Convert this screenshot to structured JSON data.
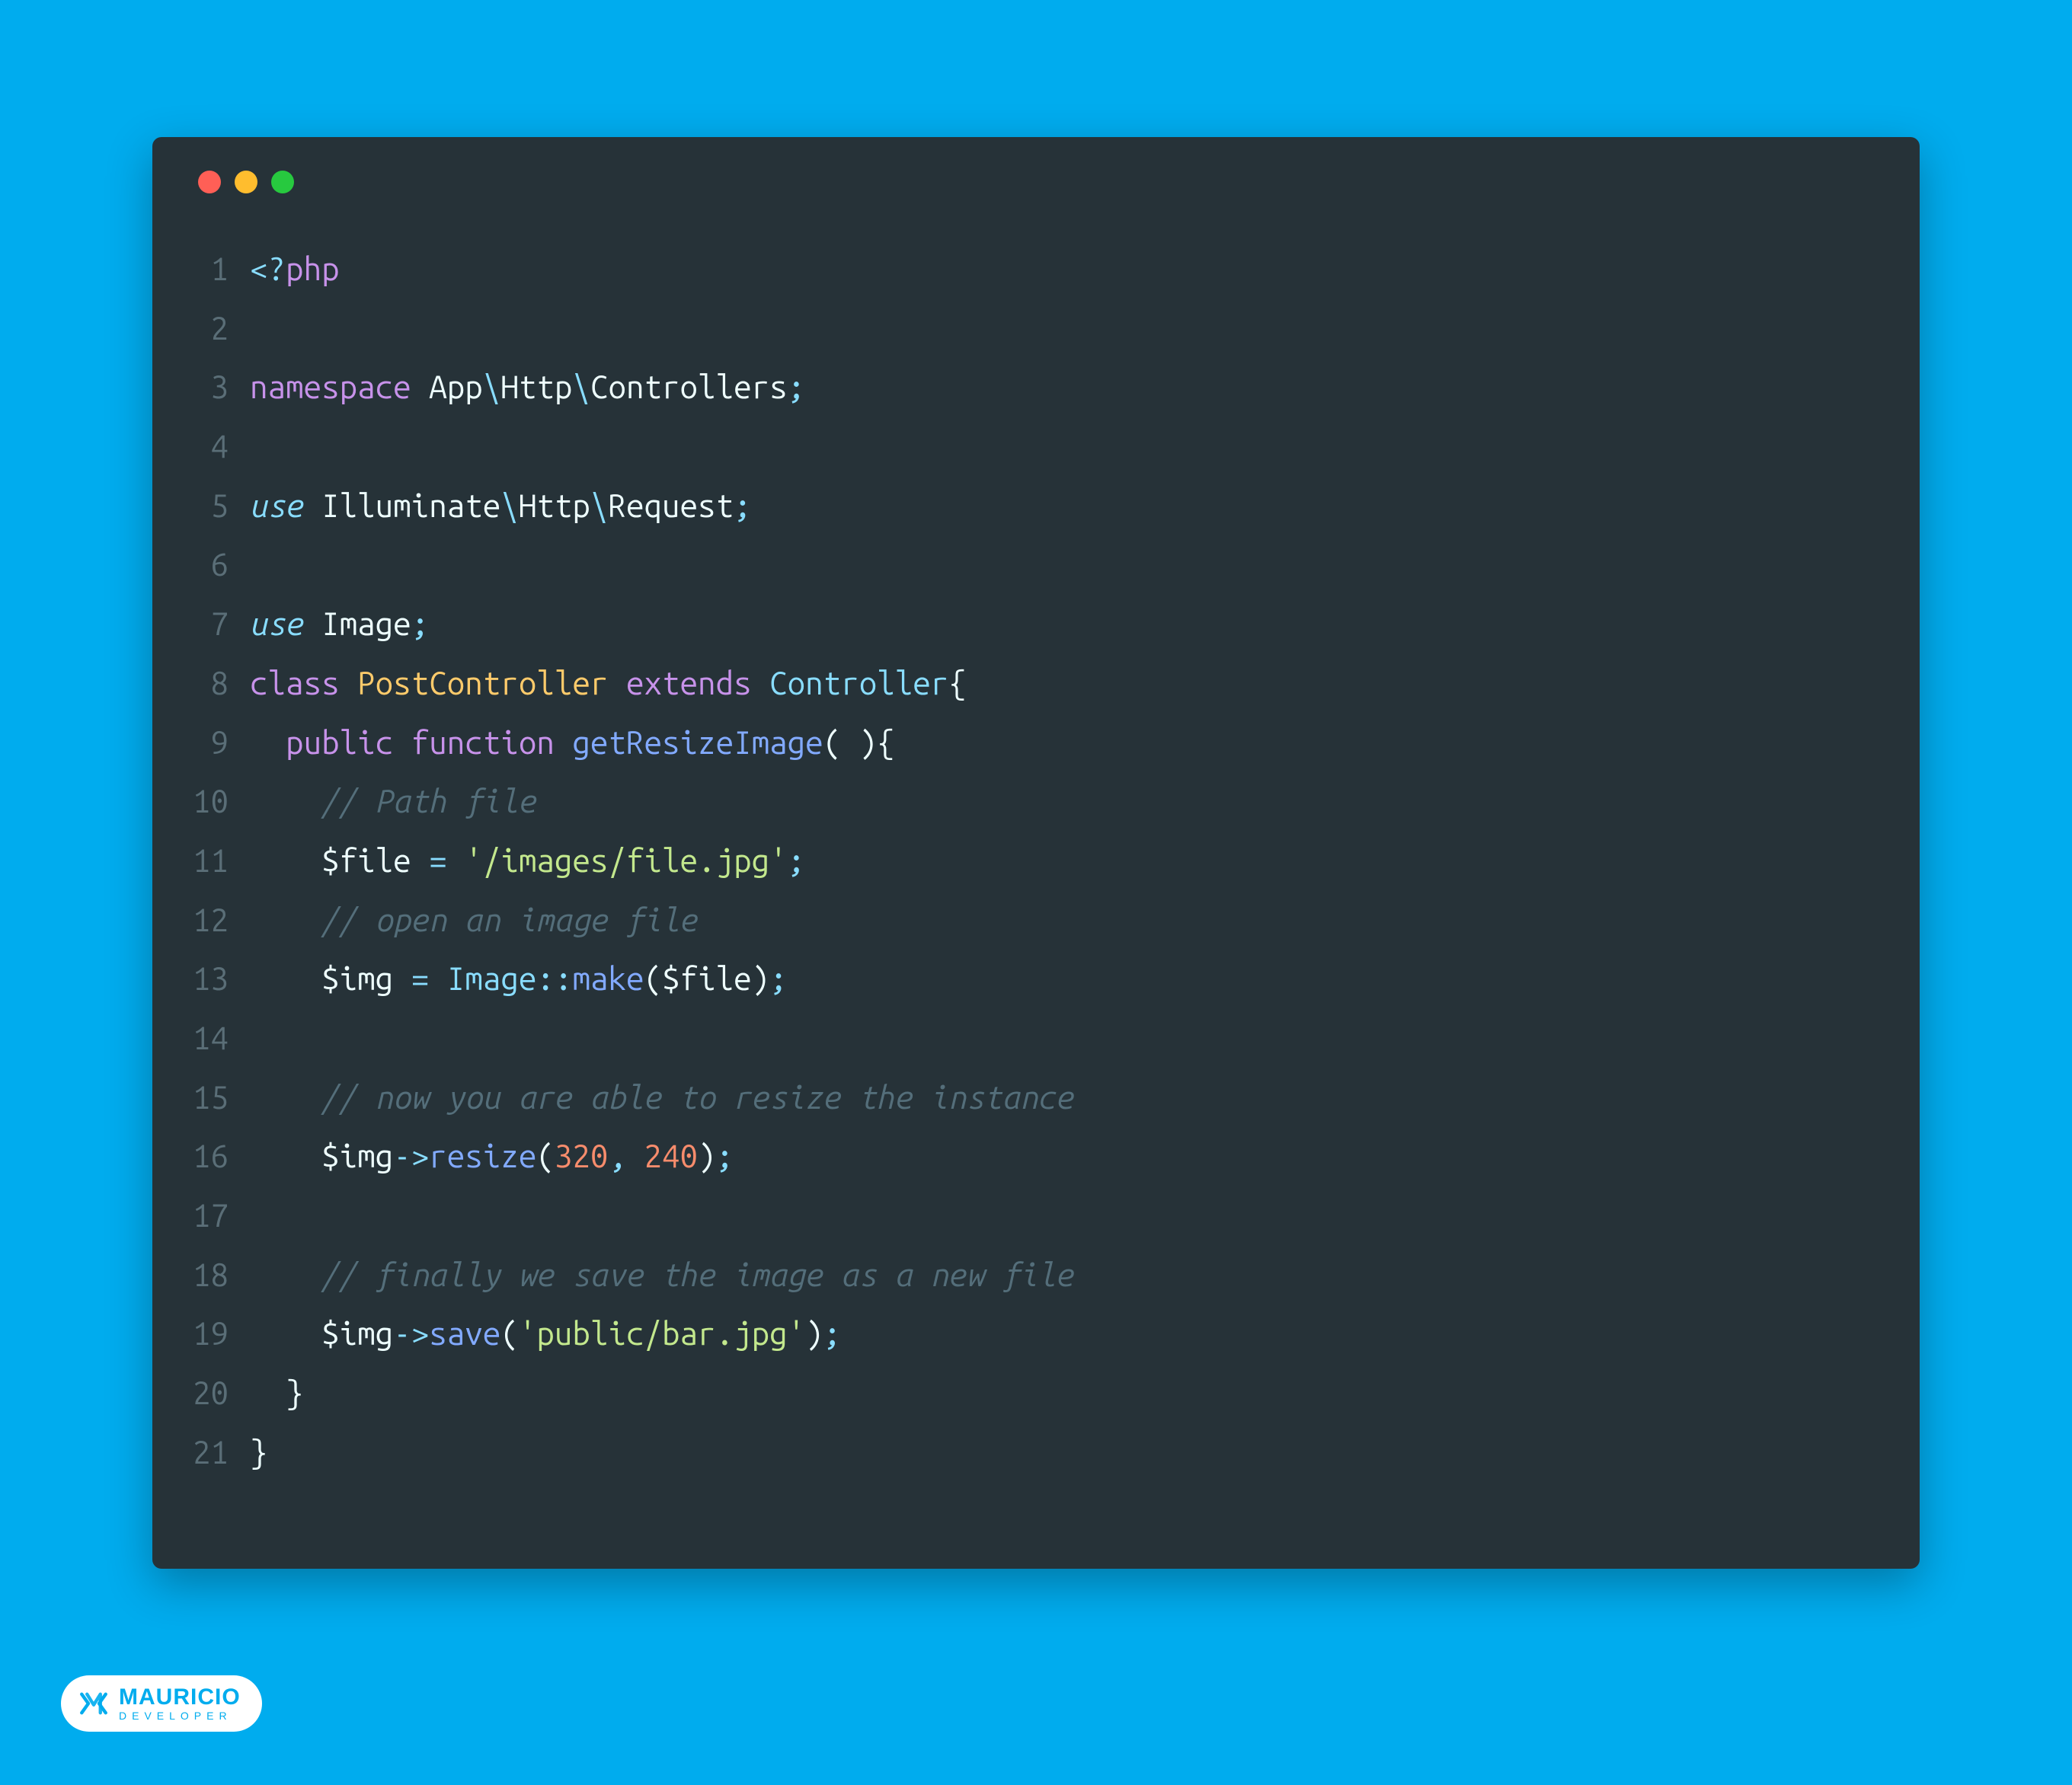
{
  "editor": {
    "lines": [
      {
        "num": "1",
        "tokens": [
          {
            "c": "tag",
            "t": "<?"
          },
          {
            "c": "keyword",
            "t": "php"
          }
        ]
      },
      {
        "num": "2",
        "tokens": []
      },
      {
        "num": "3",
        "tokens": [
          {
            "c": "keyword",
            "t": "namespace"
          },
          {
            "c": "plain",
            "t": " App"
          },
          {
            "c": "ns-sep",
            "t": "\\"
          },
          {
            "c": "plain",
            "t": "Http"
          },
          {
            "c": "ns-sep",
            "t": "\\"
          },
          {
            "c": "plain",
            "t": "Controllers"
          },
          {
            "c": "punctuation",
            "t": ";"
          }
        ]
      },
      {
        "num": "4",
        "tokens": []
      },
      {
        "num": "5",
        "tokens": [
          {
            "c": "keyword-use",
            "t": "use"
          },
          {
            "c": "plain",
            "t": " Illuminate"
          },
          {
            "c": "ns-sep",
            "t": "\\"
          },
          {
            "c": "plain",
            "t": "Http"
          },
          {
            "c": "ns-sep",
            "t": "\\"
          },
          {
            "c": "plain",
            "t": "Request"
          },
          {
            "c": "punctuation",
            "t": ";"
          }
        ]
      },
      {
        "num": "6",
        "tokens": []
      },
      {
        "num": "7",
        "tokens": [
          {
            "c": "keyword-use",
            "t": "use"
          },
          {
            "c": "plain",
            "t": " Image"
          },
          {
            "c": "punctuation",
            "t": ";"
          }
        ]
      },
      {
        "num": "8",
        "tokens": [
          {
            "c": "keyword",
            "t": "class"
          },
          {
            "c": "plain",
            "t": " "
          },
          {
            "c": "class-name",
            "t": "PostController"
          },
          {
            "c": "plain",
            "t": " "
          },
          {
            "c": "keyword",
            "t": "extends"
          },
          {
            "c": "plain",
            "t": " "
          },
          {
            "c": "class-ref",
            "t": "Controller"
          },
          {
            "c": "brace",
            "t": "{"
          }
        ]
      },
      {
        "num": "9",
        "tokens": [
          {
            "c": "plain",
            "t": "  "
          },
          {
            "c": "keyword",
            "t": "public"
          },
          {
            "c": "plain",
            "t": " "
          },
          {
            "c": "keyword",
            "t": "function"
          },
          {
            "c": "plain",
            "t": " "
          },
          {
            "c": "function-name",
            "t": "getResizeImage"
          },
          {
            "c": "paren",
            "t": "( )"
          },
          {
            "c": "brace",
            "t": "{"
          }
        ]
      },
      {
        "num": "10",
        "tokens": [
          {
            "c": "plain",
            "t": "    "
          },
          {
            "c": "comment",
            "t": "// Path file "
          }
        ]
      },
      {
        "num": "11",
        "tokens": [
          {
            "c": "plain",
            "t": "    "
          },
          {
            "c": "variable",
            "t": "$file"
          },
          {
            "c": "plain",
            "t": " "
          },
          {
            "c": "operator",
            "t": "="
          },
          {
            "c": "plain",
            "t": " "
          },
          {
            "c": "string",
            "t": "'/images/file.jpg'"
          },
          {
            "c": "punctuation",
            "t": ";"
          }
        ]
      },
      {
        "num": "12",
        "tokens": [
          {
            "c": "plain",
            "t": "    "
          },
          {
            "c": "comment",
            "t": "// open an image file"
          }
        ]
      },
      {
        "num": "13",
        "tokens": [
          {
            "c": "plain",
            "t": "    "
          },
          {
            "c": "variable",
            "t": "$img"
          },
          {
            "c": "plain",
            "t": " "
          },
          {
            "c": "operator",
            "t": "="
          },
          {
            "c": "plain",
            "t": " "
          },
          {
            "c": "class-ref",
            "t": "Image"
          },
          {
            "c": "operator",
            "t": "::"
          },
          {
            "c": "method-call",
            "t": "make"
          },
          {
            "c": "paren",
            "t": "("
          },
          {
            "c": "variable",
            "t": "$file"
          },
          {
            "c": "paren",
            "t": ")"
          },
          {
            "c": "punctuation",
            "t": ";"
          }
        ]
      },
      {
        "num": "14",
        "tokens": []
      },
      {
        "num": "15",
        "tokens": [
          {
            "c": "plain",
            "t": "    "
          },
          {
            "c": "comment",
            "t": "// now you are able to resize the instance"
          }
        ]
      },
      {
        "num": "16",
        "tokens": [
          {
            "c": "plain",
            "t": "    "
          },
          {
            "c": "variable",
            "t": "$img"
          },
          {
            "c": "operator",
            "t": "->"
          },
          {
            "c": "method-call",
            "t": "resize"
          },
          {
            "c": "paren",
            "t": "("
          },
          {
            "c": "number",
            "t": "320"
          },
          {
            "c": "punctuation",
            "t": ","
          },
          {
            "c": "plain",
            "t": " "
          },
          {
            "c": "number",
            "t": "240"
          },
          {
            "c": "paren",
            "t": ")"
          },
          {
            "c": "punctuation",
            "t": ";"
          }
        ]
      },
      {
        "num": "17",
        "tokens": []
      },
      {
        "num": "18",
        "tokens": [
          {
            "c": "plain",
            "t": "    "
          },
          {
            "c": "comment",
            "t": "// finally we save the image as a new file"
          }
        ]
      },
      {
        "num": "19",
        "tokens": [
          {
            "c": "plain",
            "t": "    "
          },
          {
            "c": "variable",
            "t": "$img"
          },
          {
            "c": "operator",
            "t": "->"
          },
          {
            "c": "method-call",
            "t": "save"
          },
          {
            "c": "paren",
            "t": "("
          },
          {
            "c": "string",
            "t": "'public/bar.jpg'"
          },
          {
            "c": "paren",
            "t": ")"
          },
          {
            "c": "punctuation",
            "t": ";"
          }
        ]
      },
      {
        "num": "20",
        "tokens": [
          {
            "c": "plain",
            "t": "  "
          },
          {
            "c": "brace",
            "t": "}"
          }
        ]
      },
      {
        "num": "21",
        "tokens": [
          {
            "c": "brace",
            "t": "}"
          }
        ]
      }
    ]
  },
  "badge": {
    "name": "MAURICIO",
    "subtitle": "DEVELOPER"
  }
}
